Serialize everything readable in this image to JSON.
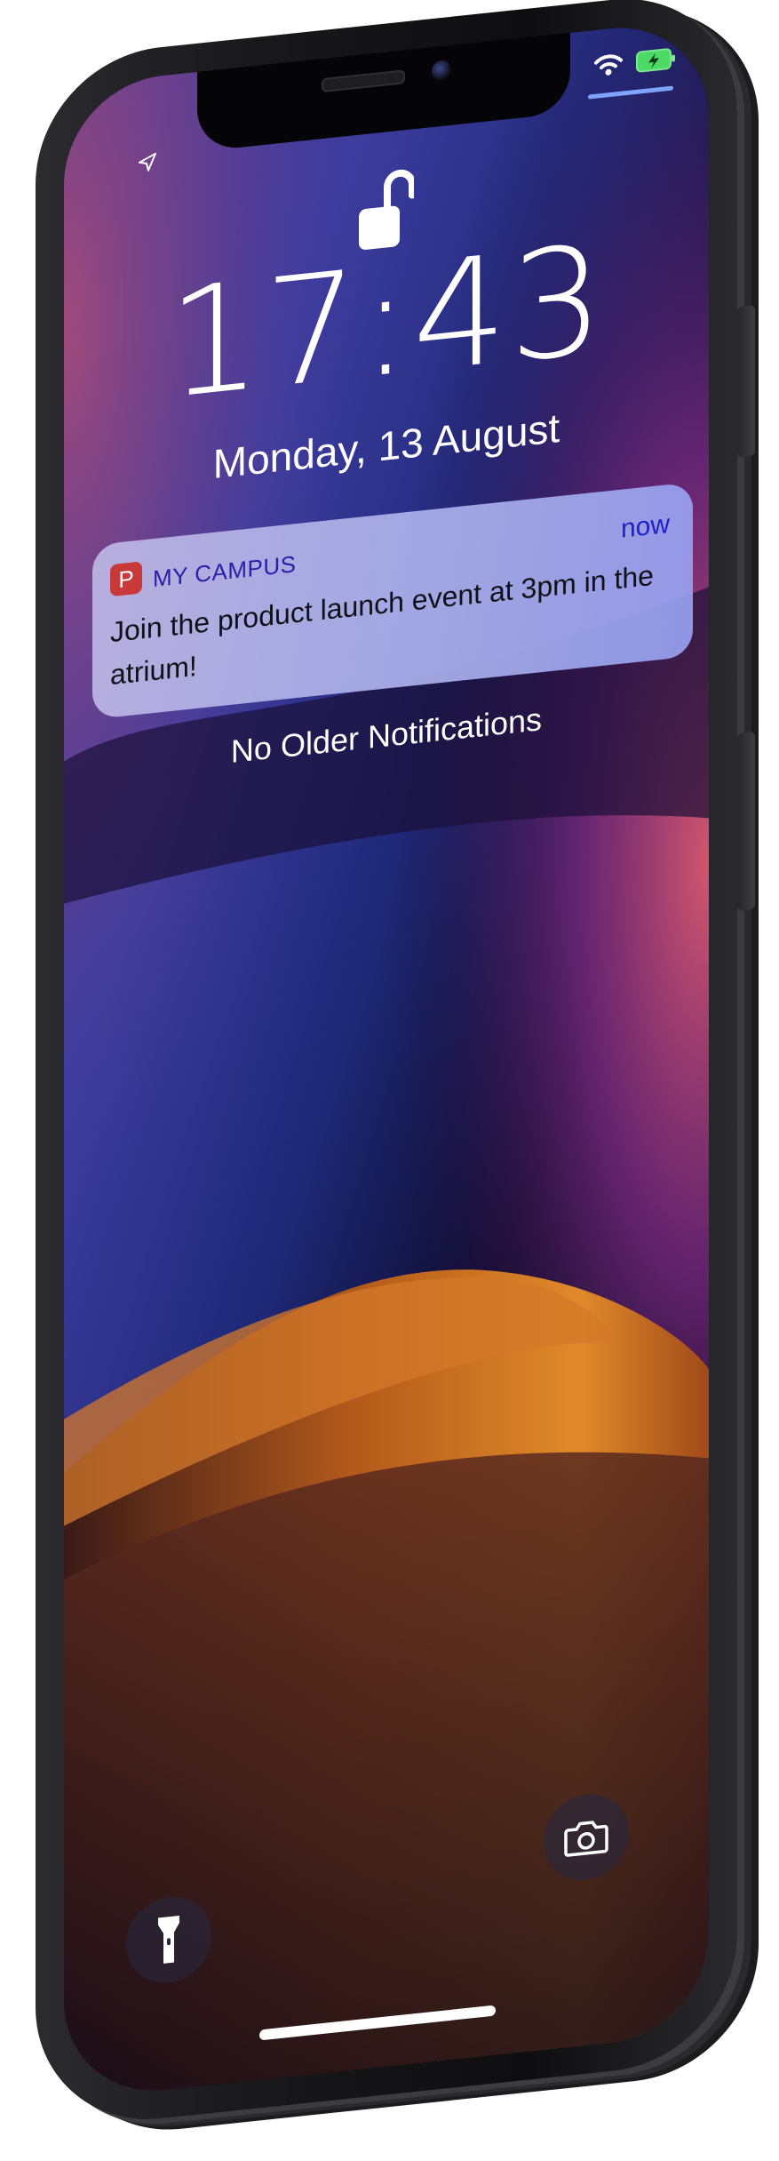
{
  "lock_screen": {
    "time": "17:43",
    "date": "Monday, 13 August",
    "empty_state": "No Older Notifications"
  },
  "notification": {
    "app_icon_letter": "P",
    "app_name": "MY CAMPUS",
    "timestamp": "now",
    "message": "Join the product launch event at 3pm in the atrium!"
  },
  "status_bar": {
    "icons": [
      "location-arrow-icon",
      "wifi-icon",
      "battery-charging-icon"
    ]
  },
  "controls": {
    "left_icon": "flashlight-icon",
    "right_icon": "camera-icon"
  },
  "colors": {
    "notification_app_icon": "#c83a3a",
    "app_name_text": "#2a1fa8",
    "battery": "#4cd964",
    "background_top": "#5b2f86",
    "background_dune": "#c56a1c"
  }
}
